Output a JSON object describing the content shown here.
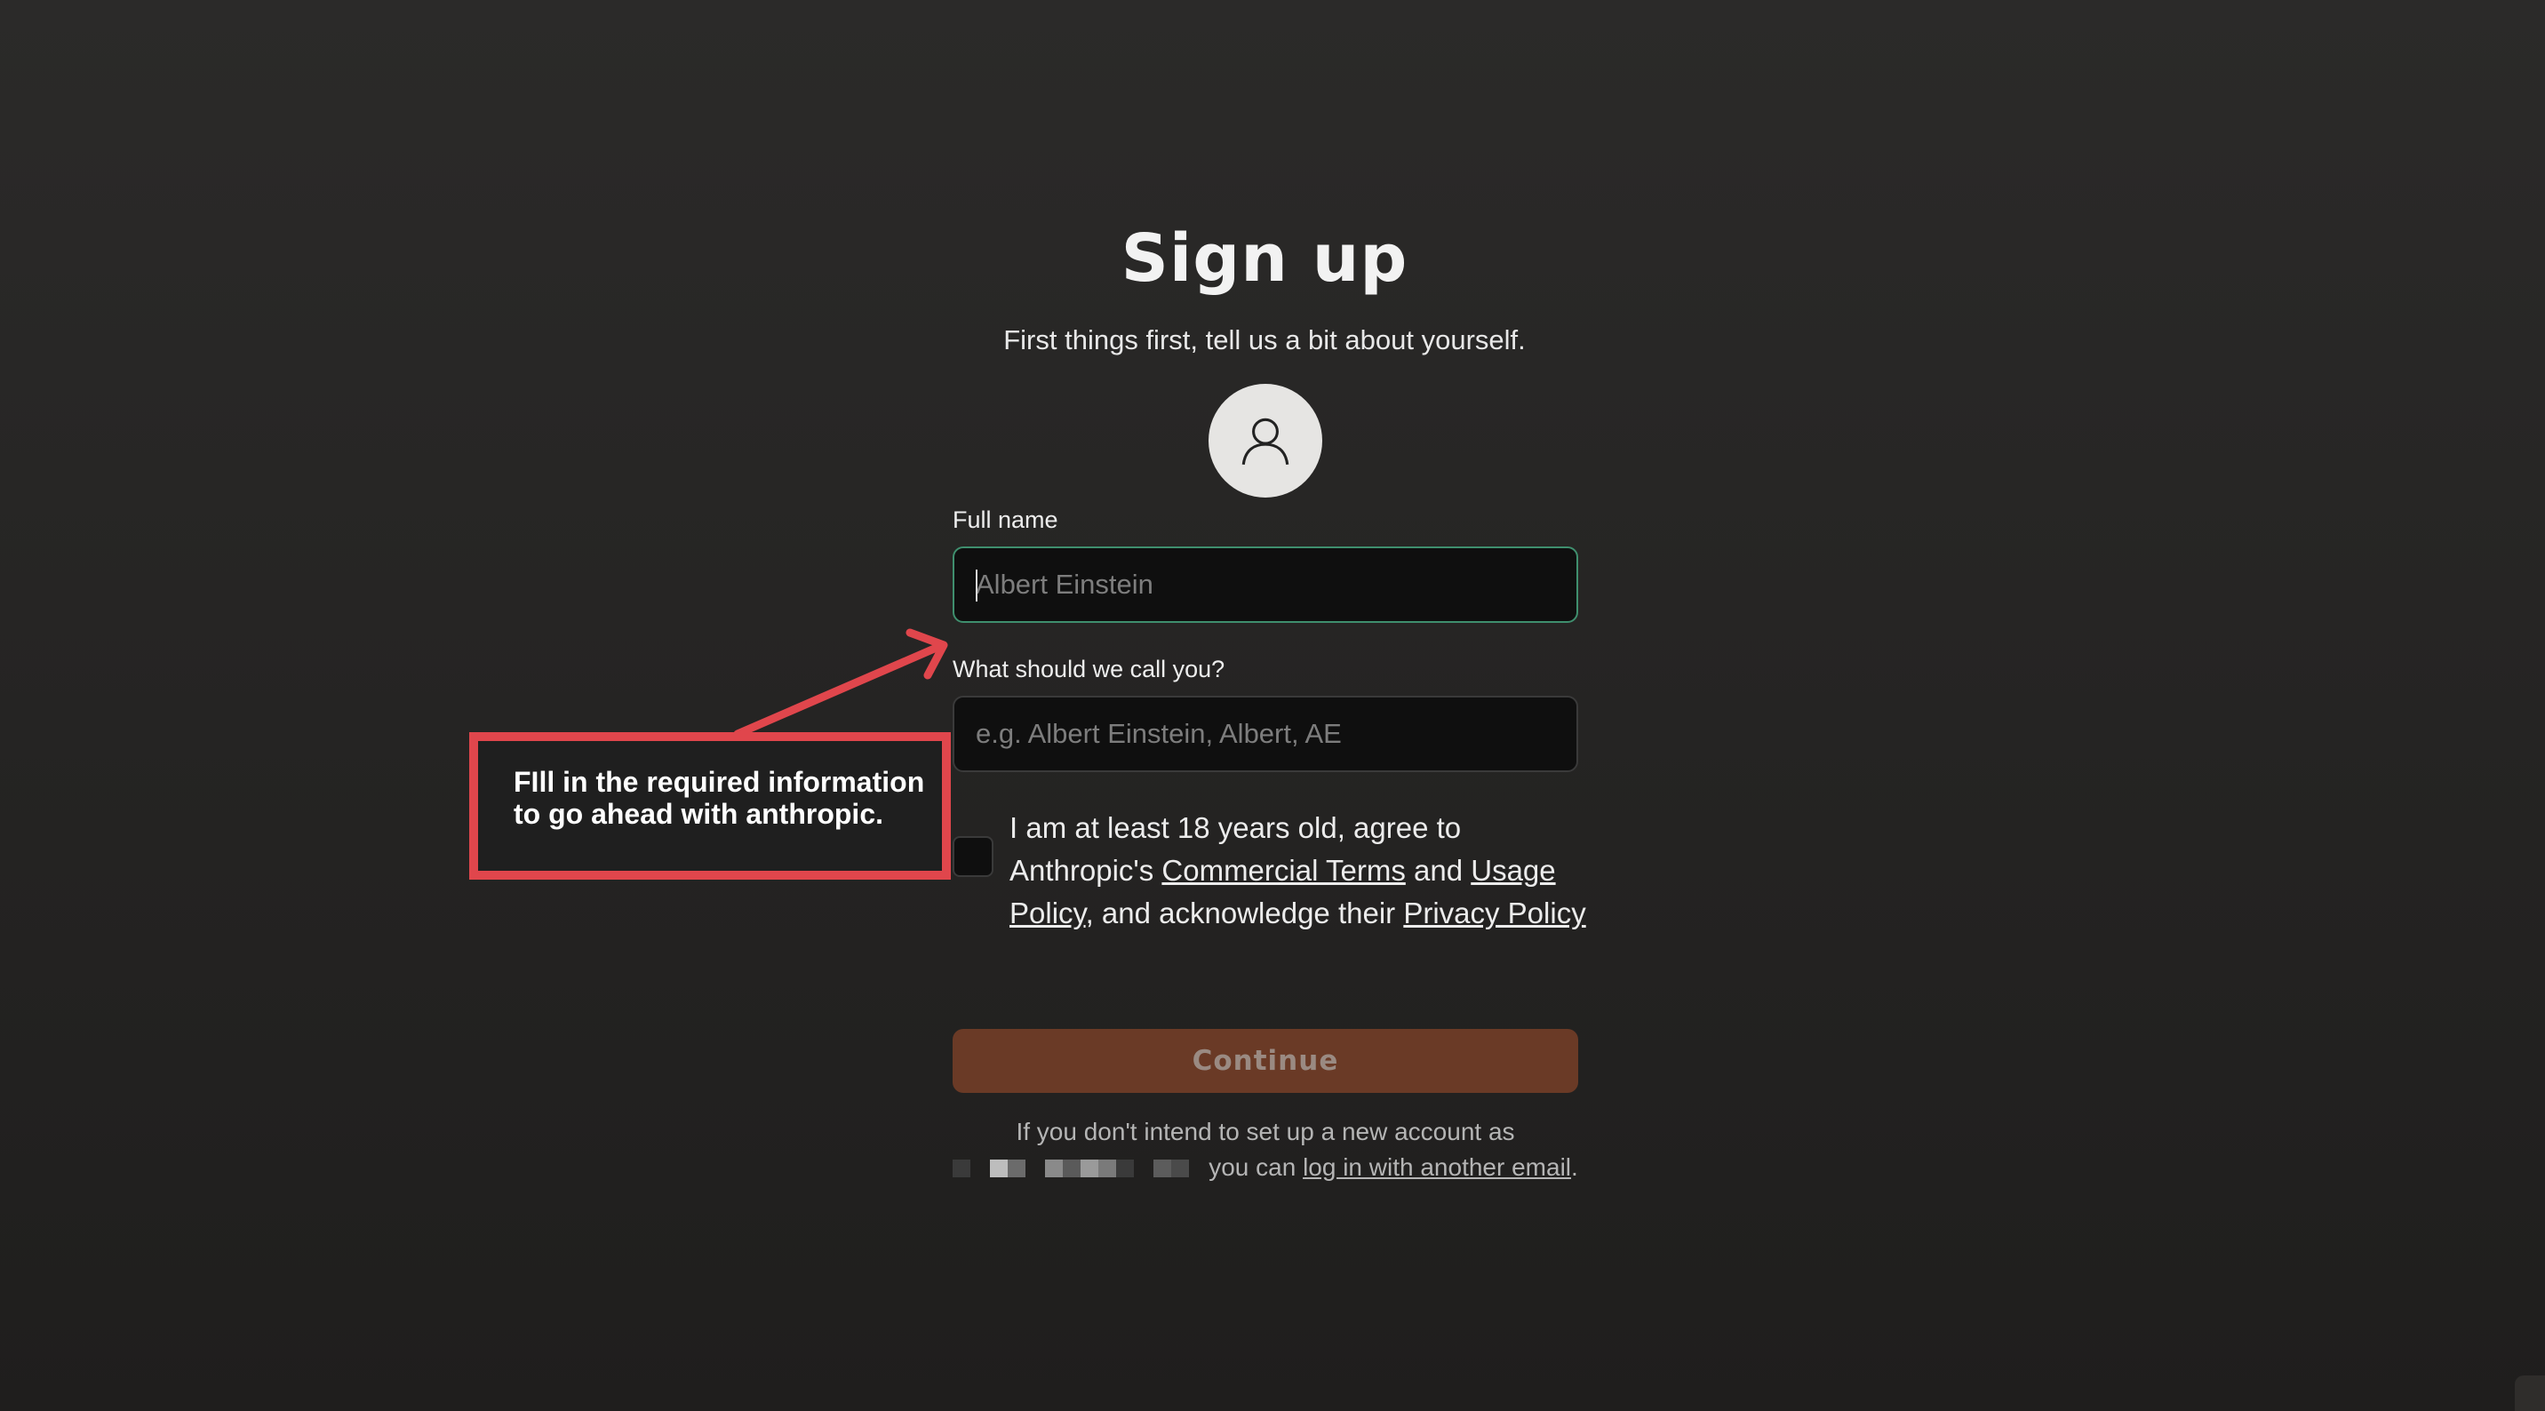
{
  "header": {
    "title": "Sign up",
    "subtitle": "First things first, tell us a bit about yourself."
  },
  "avatar": {
    "icon": "user-icon"
  },
  "form": {
    "full_name": {
      "label": "Full name",
      "placeholder": "Albert Einstein",
      "value": ""
    },
    "nickname": {
      "label": "What should we call you?",
      "placeholder": "e.g. Albert Einstein, Albert, AE",
      "value": ""
    },
    "consent": {
      "checked": false,
      "part1": "I am at least 18 years old, agree to Anthropic's ",
      "link_commercial_terms": "Commercial Terms",
      "part2": " and ",
      "link_usage_policy": "Usage Policy",
      "part3": ", and acknowledge their ",
      "link_privacy_policy": "Privacy Policy"
    },
    "continue_label": "Continue"
  },
  "footer": {
    "text_before": "If you don't intend to set up a new account as",
    "text_middle": "you can ",
    "link_text": "log in with another email",
    "text_after": "."
  },
  "annotation": {
    "text": "FIll in the required information to go ahead with anthropic.",
    "color": "#e0464c"
  },
  "colors": {
    "background": "#252423",
    "accent_focus": "#3f8f6e",
    "continue_button": "#6a3a26"
  }
}
